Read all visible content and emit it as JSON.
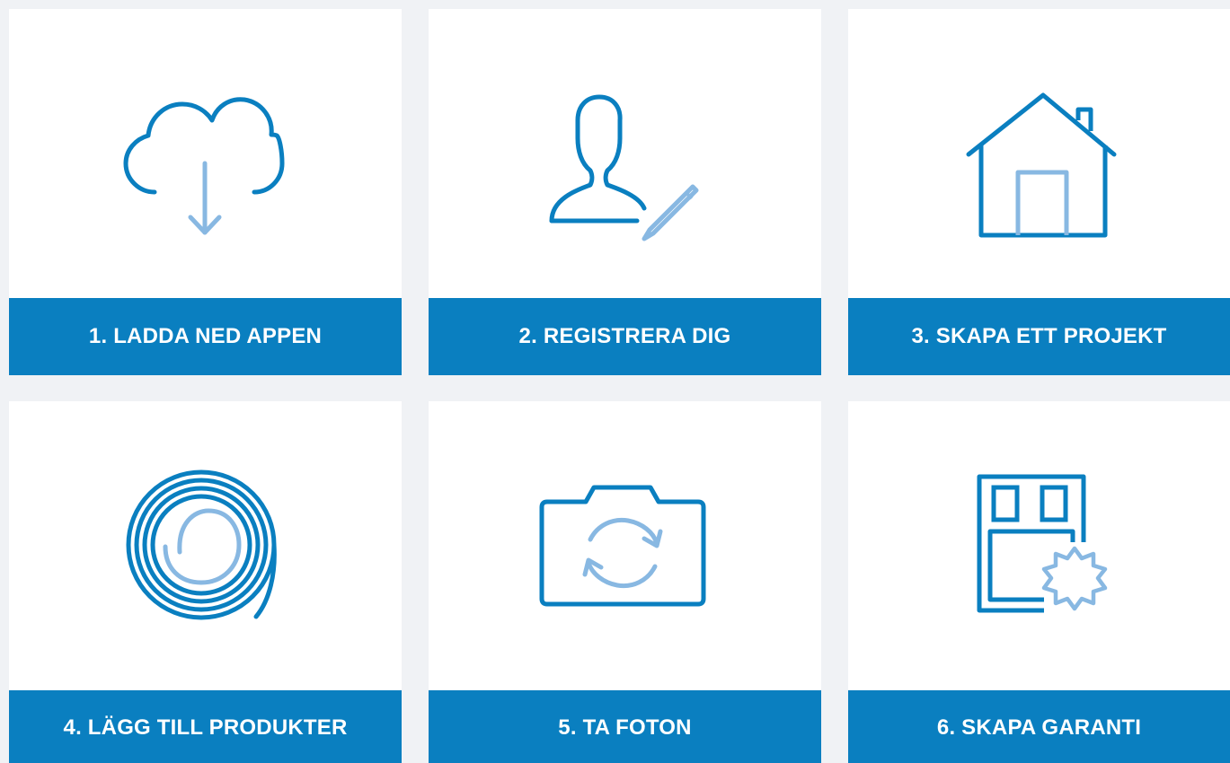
{
  "colors": {
    "background": "#f0f2f5",
    "card": "#ffffff",
    "accent": "#0a7fc0",
    "icon_dark": "#0a7fc0",
    "icon_light": "#88b8e2",
    "label_text": "#ffffff"
  },
  "steps": [
    {
      "label": "1. LADDA NED APPEN",
      "icon": "cloud-download-icon"
    },
    {
      "label": "2. REGISTRERA DIG",
      "icon": "user-edit-icon"
    },
    {
      "label": "3. SKAPA ETT PROJEKT",
      "icon": "house-icon"
    },
    {
      "label": "4. LÄGG TILL PRODUKTER",
      "icon": "cable-coil-icon"
    },
    {
      "label": "5. TA FOTON",
      "icon": "camera-rotate-icon"
    },
    {
      "label": "6. SKAPA GARANTI",
      "icon": "warranty-floorplan-icon"
    }
  ]
}
